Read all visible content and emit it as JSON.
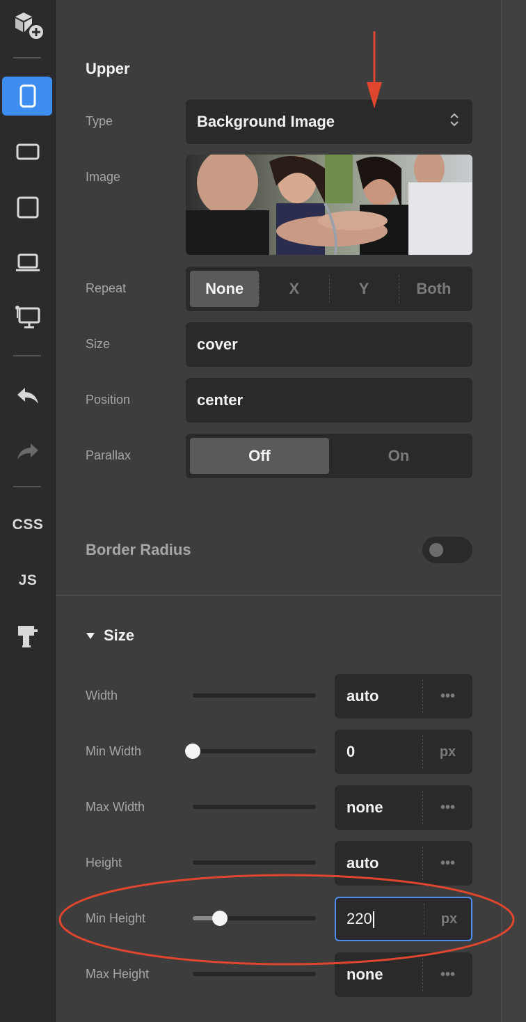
{
  "sidebar": {
    "items": [
      {
        "icon": "add-block-icon"
      },
      {
        "icon": "mobile-portrait-icon",
        "active": true
      },
      {
        "icon": "mobile-landscape-icon"
      },
      {
        "icon": "tablet-icon"
      },
      {
        "icon": "laptop-icon"
      },
      {
        "icon": "desktop-icon"
      },
      {
        "icon": "undo-icon"
      },
      {
        "icon": "redo-icon"
      }
    ],
    "css_label": "CSS",
    "js_label": "JS",
    "tool_icon": "hammer-icon",
    "active_color": "#3d8ef0"
  },
  "background": {
    "section_title": "Upper",
    "type": {
      "label": "Type",
      "value": "Background Image"
    },
    "image": {
      "label": "Image"
    },
    "repeat": {
      "label": "Repeat",
      "options": [
        "None",
        "X",
        "Y",
        "Both"
      ],
      "selected": "None"
    },
    "size": {
      "label": "Size",
      "value": "cover"
    },
    "position": {
      "label": "Position",
      "value": "center"
    },
    "parallax": {
      "label": "Parallax",
      "options": [
        "Off",
        "On"
      ],
      "selected": "Off"
    }
  },
  "border_radius": {
    "label": "Border Radius",
    "enabled": false
  },
  "size_section": {
    "title": "Size",
    "rows": [
      {
        "label": "Width",
        "value": "auto",
        "unit": "•••"
      },
      {
        "label": "Min Width",
        "value": "0",
        "unit": "px",
        "slider": 0
      },
      {
        "label": "Max Width",
        "value": "none",
        "unit": "•••"
      },
      {
        "label": "Height",
        "value": "auto",
        "unit": "•••"
      },
      {
        "label": "Min Height",
        "value": "220",
        "unit": "px",
        "slider": 0.22,
        "focused": true
      },
      {
        "label": "Max Height",
        "value": "none",
        "unit": "•••"
      }
    ]
  },
  "annotation_color": "#e0452e"
}
